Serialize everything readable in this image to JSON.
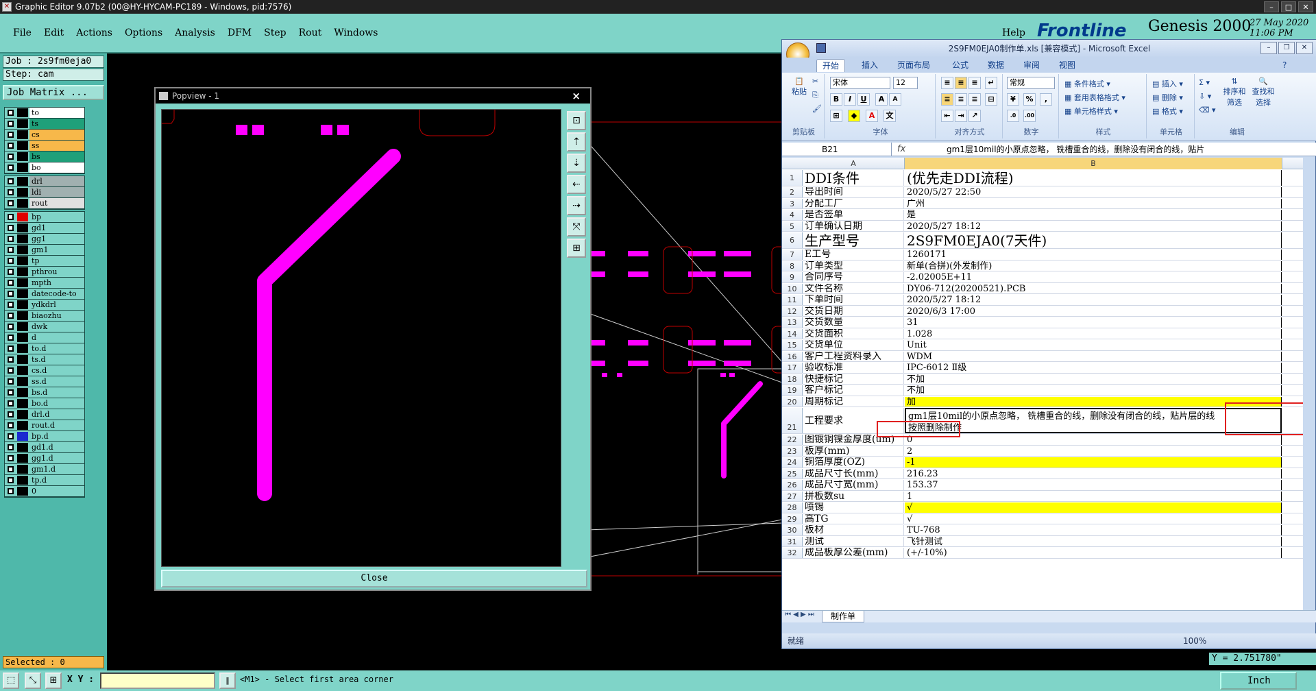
{
  "window": {
    "title": "Graphic Editor 9.07b2 (00@HY-HYCAM-PC189 - Windows, pid:7576)"
  },
  "menu": {
    "items": [
      "File",
      "Edit",
      "Actions",
      "Options",
      "Analysis",
      "DFM",
      "Step",
      "Rout",
      "Windows"
    ],
    "help": "Help"
  },
  "logo": {
    "brand": "Frontline",
    "product": "Genesis 2000",
    "date": "27 May 2020",
    "time": "11:06 PM"
  },
  "job": {
    "job": "Job  : 2s9fm0eja0",
    "step": "Step: cam",
    "matrix": "Job Matrix ..."
  },
  "layers": {
    "group1": [
      {
        "name": "to",
        "color": "#ffffff"
      },
      {
        "name": "ts",
        "color": "#1fa07a"
      },
      {
        "name": "cs",
        "color": "#f7b84a"
      },
      {
        "name": "ss",
        "color": "#f7b84a"
      },
      {
        "name": "bs",
        "color": "#1fa07a"
      },
      {
        "name": "bo",
        "color": "#ffffff"
      }
    ],
    "group2": [
      {
        "name": "drl",
        "color": "#a0b0b0"
      },
      {
        "name": "ldi",
        "color": "#a0b0b0"
      },
      {
        "name": "rout",
        "color": "#e0e0e0"
      }
    ],
    "group3": [
      {
        "name": "bp",
        "color": "#7fd4c8",
        "swatch": "#e00000"
      },
      {
        "name": "gd1",
        "color": "#7fd4c8"
      },
      {
        "name": "gg1",
        "color": "#7fd4c8"
      },
      {
        "name": "gm1",
        "color": "#7fd4c8"
      },
      {
        "name": "tp",
        "color": "#7fd4c8"
      },
      {
        "name": "pthrou",
        "color": "#7fd4c8"
      },
      {
        "name": "mpth",
        "color": "#7fd4c8"
      },
      {
        "name": "datecode-to",
        "color": "#7fd4c8"
      },
      {
        "name": "ydkdrl",
        "color": "#7fd4c8"
      },
      {
        "name": "biaozhu",
        "color": "#7fd4c8"
      },
      {
        "name": "dwk",
        "color": "#7fd4c8"
      },
      {
        "name": "d",
        "color": "#7fd4c8"
      },
      {
        "name": "to.d",
        "color": "#7fd4c8"
      },
      {
        "name": "ts.d",
        "color": "#7fd4c8"
      },
      {
        "name": "cs.d",
        "color": "#7fd4c8"
      },
      {
        "name": "ss.d",
        "color": "#7fd4c8"
      },
      {
        "name": "bs.d",
        "color": "#7fd4c8"
      },
      {
        "name": "bo.d",
        "color": "#7fd4c8"
      },
      {
        "name": "drl.d",
        "color": "#7fd4c8"
      },
      {
        "name": "rout.d",
        "color": "#7fd4c8"
      },
      {
        "name": "bp.d",
        "color": "#7fd4c8",
        "swatch": "#1a2ad0"
      },
      {
        "name": "gd1.d",
        "color": "#7fd4c8"
      },
      {
        "name": "gg1.d",
        "color": "#7fd4c8"
      },
      {
        "name": "gm1.d",
        "color": "#7fd4c8"
      },
      {
        "name": "tp.d",
        "color": "#7fd4c8"
      },
      {
        "name": "0",
        "color": "#7fd4c8"
      }
    ]
  },
  "status": {
    "selected": "Selected : 0",
    "xy_label": "X Y :",
    "prompt": "<M1> - Select first area corner",
    "units": "Inch",
    "y_coord": "Y = 2.751780\""
  },
  "popview": {
    "title": "Popview - 1",
    "close_label": "Close",
    "close_x": "×"
  },
  "excel": {
    "title": "2S9FM0EJA0制作单.xls  [兼容模式] - Microsoft Excel",
    "tabs": [
      "开始",
      "插入",
      "页面布局",
      "公式",
      "数据",
      "审阅",
      "视图"
    ],
    "ribbon": {
      "paste": "粘贴",
      "clipboard": "剪贴板",
      "font_name": "宋体",
      "font_size": "12",
      "font_group": "字体",
      "align_group": "对齐方式",
      "number_format": "常规",
      "number_group": "数字",
      "cond_format": "条件格式",
      "table_format": "套用表格格式",
      "cell_style": "单元格样式",
      "style_group": "样式",
      "insert": "插入",
      "delete": "删除",
      "format": "格式",
      "cells_group": "单元格",
      "sort": "排序和\n筛选",
      "find": "查找和\n选择",
      "edit_group": "编辑"
    },
    "name_box": "B21",
    "formula": "gm1层10mil的小原点忽略，   铣槽重合的线，删除没有闭合的线，贴片",
    "columns": [
      "A",
      "B"
    ],
    "rows": [
      {
        "n": "1",
        "a": "DDI条件",
        "b": "(优先走DDI流程)",
        "big": true
      },
      {
        "n": "2",
        "a": "导出时间",
        "b": "2020/5/27 22:50"
      },
      {
        "n": "3",
        "a": "分配工厂",
        "b": "广州"
      },
      {
        "n": "4",
        "a": "是否签单",
        "b": "是"
      },
      {
        "n": "5",
        "a": "订单确认日期",
        "b": "2020/5/27 18:12"
      },
      {
        "n": "6",
        "a": "生产型号",
        "b": "2S9FM0EJA0(7天件)",
        "big": true
      },
      {
        "n": "7",
        "a": "E工号",
        "b": "1260171"
      },
      {
        "n": "8",
        "a": "订单类型",
        "b": "新单(合拼)(外发制作)"
      },
      {
        "n": "9",
        "a": "合同序号",
        "b": "-2.02005E+11"
      },
      {
        "n": "10",
        "a": "文件名称",
        "b": "DY06-712(20200521).PCB"
      },
      {
        "n": "11",
        "a": "下单时间",
        "b": "2020/5/27 18:12"
      },
      {
        "n": "12",
        "a": "交货日期",
        "b": "2020/6/3 17:00"
      },
      {
        "n": "13",
        "a": "交货数量",
        "b": "31"
      },
      {
        "n": "14",
        "a": "交货面积",
        "b": "1.028"
      },
      {
        "n": "15",
        "a": "交货单位",
        "b": "Unit"
      },
      {
        "n": "16",
        "a": "客户工程资料录入",
        "b": "WDM"
      },
      {
        "n": "17",
        "a": "验收标准",
        "b": "IPC-6012 Ⅱ级"
      },
      {
        "n": "18",
        "a": "快捷标记",
        "b": "不加"
      },
      {
        "n": "19",
        "a": "客户标记",
        "b": "不加"
      },
      {
        "n": "20",
        "a": "周期标记",
        "b": "加",
        "yellow": true
      },
      {
        "n": "21",
        "a": "工程要求",
        "b": "gm1层10mil的小原点忽略，   铣槽重合的线，删除没有闭合的线，贴片层的线",
        "b2": "按照删除制作",
        "tall": true
      },
      {
        "n": "22",
        "a": "图镀铜镍金厚度(um)",
        "b": "0"
      },
      {
        "n": "23",
        "a": "板厚(mm)",
        "b": "2"
      },
      {
        "n": "24",
        "a": "铜箔厚度(OZ)",
        "b": "-1",
        "yellow": true
      },
      {
        "n": "25",
        "a": "成品尺寸长(mm)",
        "b": "216.23"
      },
      {
        "n": "26",
        "a": "成品尺寸宽(mm)",
        "b": "153.37"
      },
      {
        "n": "27",
        "a": "拼板数su",
        "b": "1"
      },
      {
        "n": "28",
        "a": "喷锡",
        "b": "√",
        "yellow": true
      },
      {
        "n": "29",
        "a": "高TG",
        "b": "√"
      },
      {
        "n": "30",
        "a": "板材",
        "b": "TU-768"
      },
      {
        "n": "31",
        "a": "测试",
        "b": "飞针测试"
      },
      {
        "n": "32",
        "a": "成品板厚公差(mm)",
        "b": "(+/-10%)"
      }
    ],
    "sheet_tab": "制作单",
    "status": "就绪",
    "zoom": "100%"
  },
  "colors": {
    "teal": "#7fd4c8",
    "magenta": "#ff00ff",
    "outline_red": "#c00000"
  }
}
